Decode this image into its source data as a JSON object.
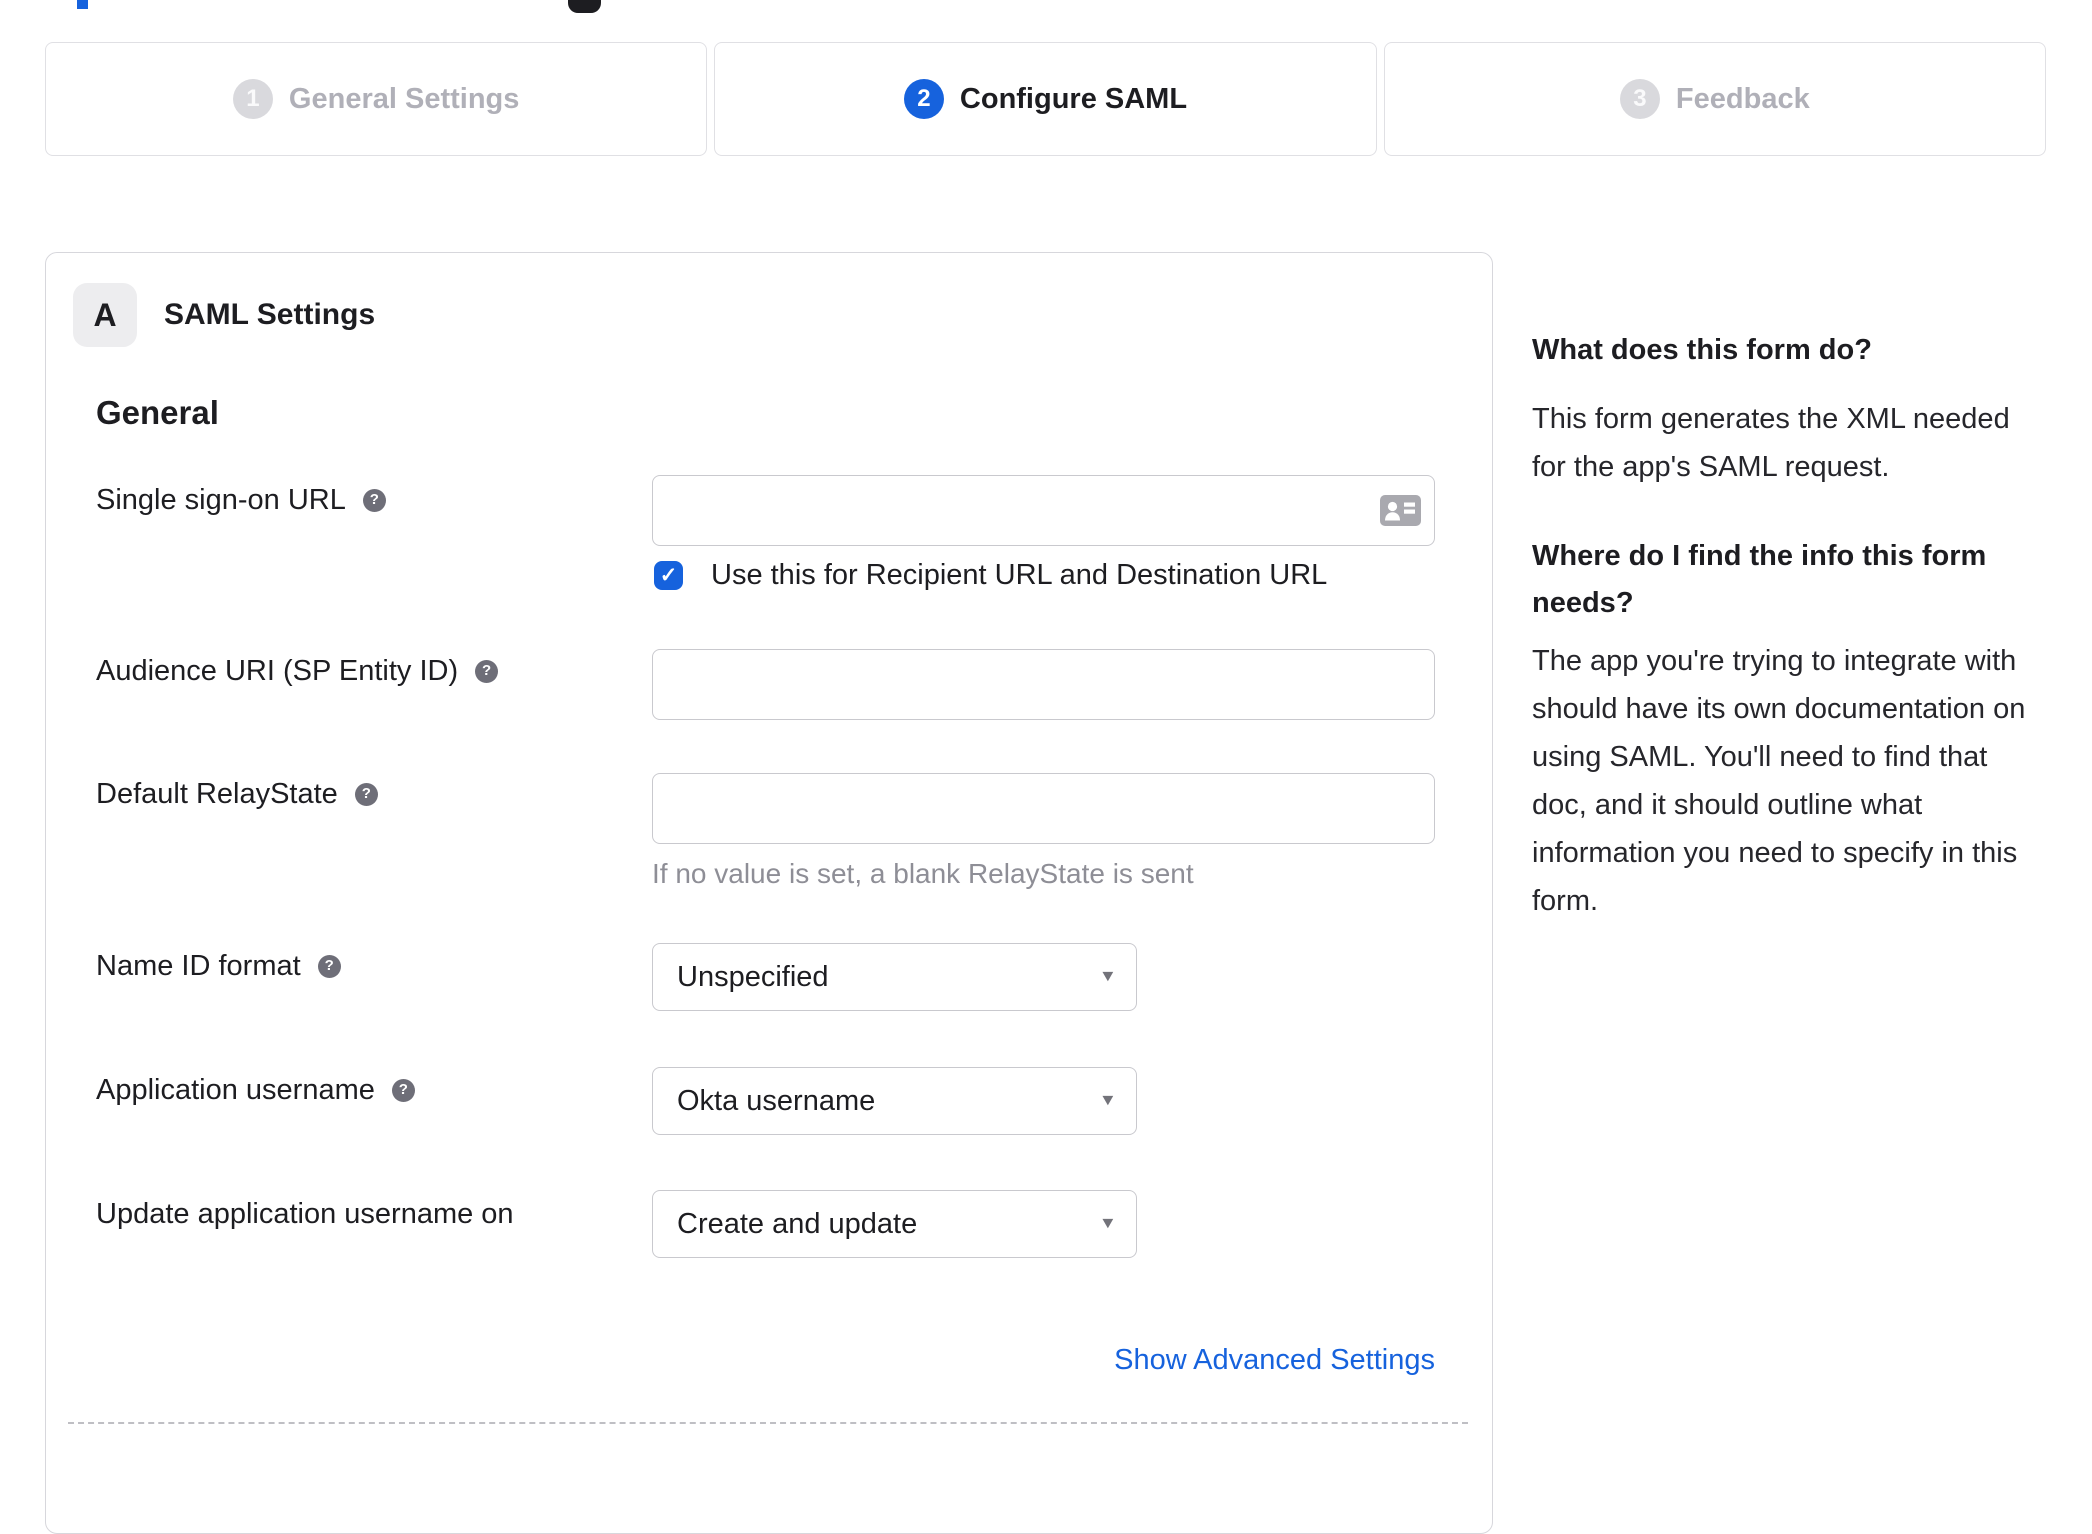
{
  "colors": {
    "accent_blue": "#1662dd",
    "text_dark": "#1d1d21",
    "inactive_gray": "#b0b0b8",
    "border_gray": "#d7d7dc",
    "input_border": "#c9c9ce",
    "help_icon_gray": "#6e6e78",
    "hint_gray": "#8e8e96"
  },
  "decor": {
    "top_blue_fragment_color": "#1662dd",
    "top_dark_fragment_color": "#1d1d21"
  },
  "icons": {
    "help": "?",
    "dropdown_arrow": "▼",
    "checkmark": "✓",
    "contact_card": "contact-card-icon"
  },
  "stepper": {
    "steps": [
      {
        "number": "1",
        "label": "General Settings",
        "state": "inactive"
      },
      {
        "number": "2",
        "label": "Configure SAML",
        "state": "active"
      },
      {
        "number": "3",
        "label": "Feedback",
        "state": "inactive"
      }
    ]
  },
  "panel": {
    "badge": "A",
    "title": "SAML Settings",
    "section": "General",
    "fields": {
      "sso": {
        "label": "Single sign-on URL",
        "value": "",
        "has_help": true
      },
      "sso_checkbox": {
        "label": "Use this for Recipient URL and Destination URL",
        "checked": true
      },
      "audience": {
        "label": "Audience URI (SP Entity ID)",
        "value": "",
        "has_help": true
      },
      "relay": {
        "label": "Default RelayState",
        "value": "",
        "has_help": true,
        "hint": "If no value is set, a blank RelayState is sent"
      },
      "name_id": {
        "label": "Name ID format",
        "value": "Unspecified",
        "has_help": true
      },
      "app_username": {
        "label": "Application username",
        "value": "Okta username",
        "has_help": true
      },
      "update_on": {
        "label": "Update application username on",
        "value": "Create and update",
        "has_help": false
      }
    },
    "advanced_link": "Show Advanced Settings"
  },
  "sidebar": {
    "q1": "What does this form do?",
    "p1": {
      "lines": [
        "This form generates the XML needed",
        "for the app's SAML request."
      ]
    },
    "q2": {
      "lines": [
        "Where do I find the info this form",
        "needs?"
      ]
    },
    "p2": {
      "lines": [
        "The app you're trying to integrate with",
        "should have its own documentation on",
        "using SAML. You'll need to find that",
        "doc, and it should outline what",
        "information you need to specify in this",
        "form."
      ]
    }
  }
}
